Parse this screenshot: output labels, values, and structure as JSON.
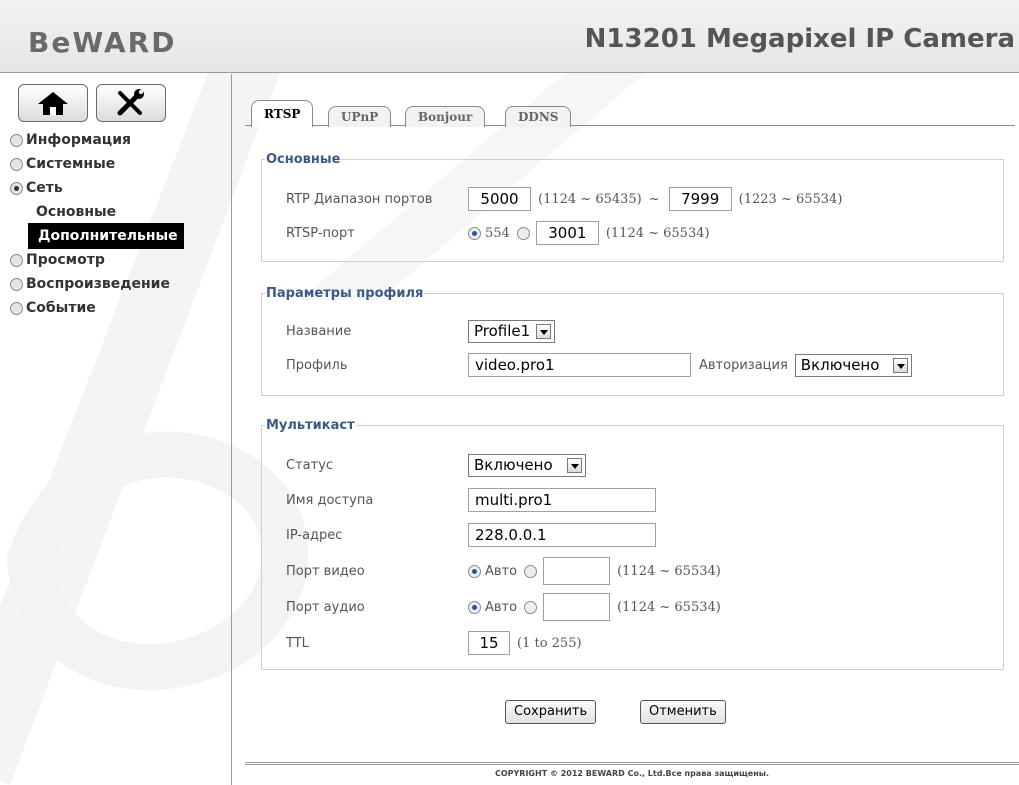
{
  "header": {
    "logo": "BeWARD",
    "model": "N13201 Megapixel IP Camera"
  },
  "sidebar": {
    "items": [
      {
        "label": "Информация",
        "state": "closed"
      },
      {
        "label": "Системные",
        "state": "closed"
      },
      {
        "label": "Сеть",
        "state": "open"
      },
      {
        "label": "Основные",
        "sub": true
      },
      {
        "label": "Дополнительные",
        "sub": true,
        "active": true
      },
      {
        "label": "Просмотр",
        "state": "closed"
      },
      {
        "label": "Воспроизведение",
        "state": "closed"
      },
      {
        "label": "Событие",
        "state": "closed"
      }
    ]
  },
  "tabs": [
    "RTSP",
    "UPnP",
    "Bonjour",
    "DDNS"
  ],
  "basic": {
    "legend": "Основные",
    "rtp_label": "RTP Диапазон портов",
    "rtp_start": "5000",
    "rtp_start_range": "(1124 ~ 65435)",
    "tilde": "~",
    "rtp_end": "7999",
    "rtp_end_range": "(1223 ~ 65534)",
    "rtsp_label": "RTSP-порт",
    "rtsp_default": "554",
    "rtsp_custom": "3001",
    "rtsp_range": "(1124 ~ 65534)"
  },
  "profile": {
    "legend": "Параметры профиля",
    "name_label": "Название",
    "name_value": "Profile1",
    "profile_label": "Профиль",
    "profile_value": "video.pro1",
    "auth_label": "Авторизация",
    "auth_value": "Включено"
  },
  "multicast": {
    "legend": "Мультикаст",
    "status_label": "Статус",
    "status_value": "Включено",
    "access_label": "Имя доступа",
    "access_value": "multi.pro1",
    "ip_label": "IP-адрес",
    "ip_value": "228.0.0.1",
    "video_label": "Порт видео",
    "auto": "Авто",
    "port_range": "(1124 ~ 65534)",
    "audio_label": "Порт аудио",
    "ttl_label": "TTL",
    "ttl_value": "15",
    "ttl_range": "(1 to 255)"
  },
  "buttons": {
    "save": "Сохранить",
    "cancel": "Отменить"
  },
  "footer": "COPYRIGHT © 2012 BEWARD Co., Ltd.Все права защищены."
}
